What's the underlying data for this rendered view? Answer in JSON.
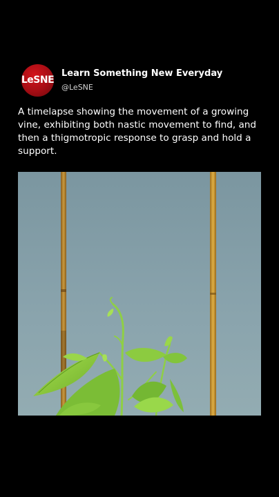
{
  "post": {
    "account": {
      "avatar_text": "LeSNE",
      "name": "Learn Something New Everyday",
      "handle": "@LeSNE"
    },
    "caption": "A timelapse showing the movement of a growing vine, exhibiting both nastic movement to find, and then a thigmotropic response to grasp and hold a support.",
    "media": {
      "type": "video-frame"
    }
  },
  "colors": {
    "background": "#000000",
    "avatar_red": "#c8101a",
    "text": "#ffffff",
    "backdrop": "#8aa4ad",
    "leaf": "#86c93a",
    "stake": "#c99a3e"
  }
}
